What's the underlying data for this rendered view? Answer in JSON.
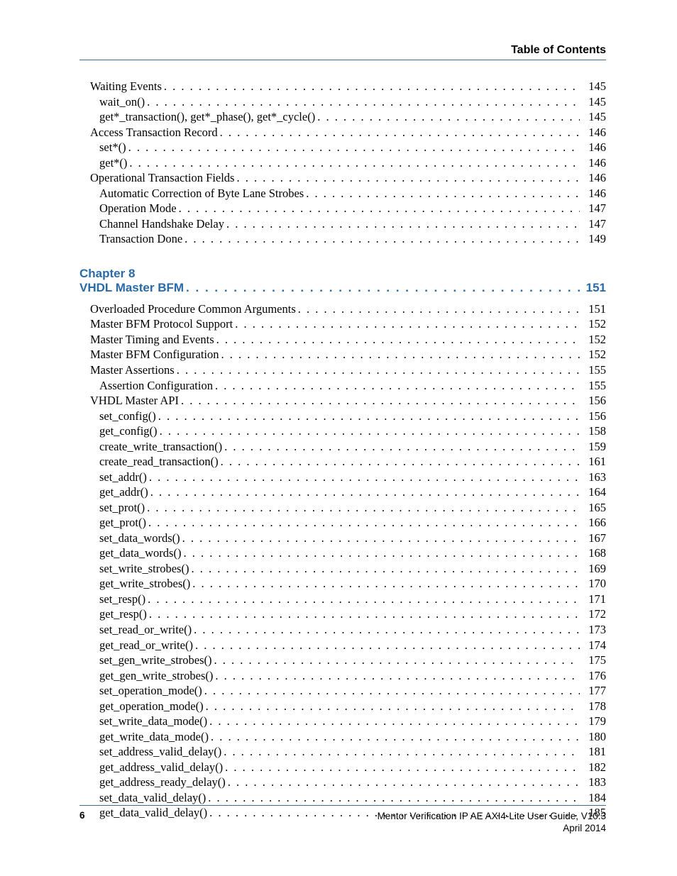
{
  "header": {
    "title": "Table of Contents"
  },
  "section1": {
    "entries": [
      {
        "indent": 0,
        "title": "Waiting Events",
        "page": "145"
      },
      {
        "indent": 1,
        "title": "wait_on()",
        "page": "145"
      },
      {
        "indent": 1,
        "title": "get*_transaction(), get*_phase(), get*_cycle()",
        "page": "145"
      },
      {
        "indent": 0,
        "title": "Access Transaction Record",
        "page": "146"
      },
      {
        "indent": 1,
        "title": "set*()",
        "page": "146"
      },
      {
        "indent": 1,
        "title": "get*()",
        "page": "146"
      },
      {
        "indent": 0,
        "title": "Operational Transaction Fields",
        "page": "146"
      },
      {
        "indent": 1,
        "title": "Automatic Correction of Byte Lane Strobes",
        "page": "146"
      },
      {
        "indent": 1,
        "title": "Operation Mode",
        "page": "147"
      },
      {
        "indent": 1,
        "title": "Channel Handshake Delay",
        "page": "147"
      },
      {
        "indent": 1,
        "title": "Transaction Done",
        "page": "149"
      }
    ]
  },
  "chapter": {
    "label": "Chapter 8",
    "title": "VHDL Master BFM",
    "page": "151",
    "entries": [
      {
        "indent": 0,
        "title": "Overloaded Procedure Common Arguments",
        "page": "151"
      },
      {
        "indent": 0,
        "title": "Master BFM Protocol Support",
        "page": "152"
      },
      {
        "indent": 0,
        "title": "Master Timing and Events",
        "page": "152"
      },
      {
        "indent": 0,
        "title": "Master BFM Configuration",
        "page": "152"
      },
      {
        "indent": 0,
        "title": "Master Assertions",
        "page": "155"
      },
      {
        "indent": 1,
        "title": "Assertion Configuration",
        "page": "155"
      },
      {
        "indent": 0,
        "title": "VHDL Master API",
        "page": "156"
      },
      {
        "indent": 1,
        "title": "set_config()",
        "page": "156"
      },
      {
        "indent": 1,
        "title": "get_config()",
        "page": "158"
      },
      {
        "indent": 1,
        "title": "create_write_transaction()",
        "page": "159"
      },
      {
        "indent": 1,
        "title": "create_read_transaction()",
        "page": "161"
      },
      {
        "indent": 1,
        "title": "set_addr()",
        "page": "163"
      },
      {
        "indent": 1,
        "title": "get_addr()",
        "page": "164"
      },
      {
        "indent": 1,
        "title": "set_prot()",
        "page": "165"
      },
      {
        "indent": 1,
        "title": "get_prot()",
        "page": "166"
      },
      {
        "indent": 1,
        "title": "set_data_words()",
        "page": "167"
      },
      {
        "indent": 1,
        "title": "get_data_words()",
        "page": "168"
      },
      {
        "indent": 1,
        "title": "set_write_strobes()",
        "page": "169"
      },
      {
        "indent": 1,
        "title": "get_write_strobes()",
        "page": "170"
      },
      {
        "indent": 1,
        "title": "set_resp()",
        "page": "171"
      },
      {
        "indent": 1,
        "title": "get_resp()",
        "page": "172"
      },
      {
        "indent": 1,
        "title": "set_read_or_write()",
        "page": "173"
      },
      {
        "indent": 1,
        "title": "get_read_or_write()",
        "page": "174"
      },
      {
        "indent": 1,
        "title": "set_gen_write_strobes()",
        "page": "175"
      },
      {
        "indent": 1,
        "title": "get_gen_write_strobes()",
        "page": "176"
      },
      {
        "indent": 1,
        "title": "set_operation_mode()",
        "page": "177"
      },
      {
        "indent": 1,
        "title": "get_operation_mode()",
        "page": "178"
      },
      {
        "indent": 1,
        "title": "set_write_data_mode()",
        "page": "179"
      },
      {
        "indent": 1,
        "title": "get_write_data_mode()",
        "page": "180"
      },
      {
        "indent": 1,
        "title": "set_address_valid_delay()",
        "page": "181"
      },
      {
        "indent": 1,
        "title": "get_address_valid_delay()",
        "page": "182"
      },
      {
        "indent": 1,
        "title": "get_address_ready_delay()",
        "page": "183"
      },
      {
        "indent": 1,
        "title": "set_data_valid_delay()",
        "page": "184"
      },
      {
        "indent": 1,
        "title": "get_data_valid_delay()",
        "page": "185"
      }
    ]
  },
  "footer": {
    "page_number": "6",
    "doc_title": "Mentor Verification IP AE AXI4-Lite User Guide, V10.3",
    "date": "April 2014"
  }
}
